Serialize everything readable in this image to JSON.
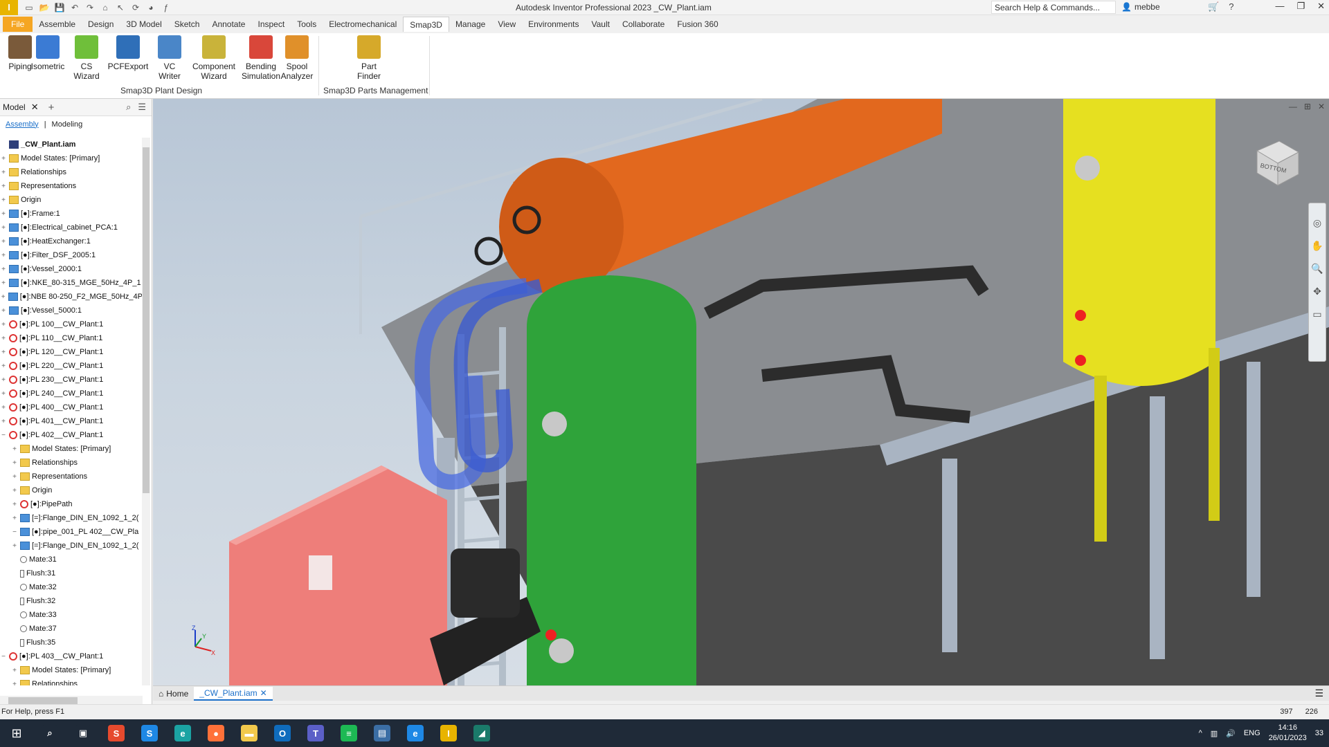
{
  "window": {
    "title": "Autodesk Inventor Professional 2023   _CW_Plant.iam",
    "search_placeholder": "Search Help & Commands...",
    "user": "mebbe"
  },
  "menu_tabs": [
    "File",
    "Assemble",
    "Design",
    "3D Model",
    "Sketch",
    "Annotate",
    "Inspect",
    "Tools",
    "Electromechanical",
    "Smap3D",
    "Manage",
    "View",
    "Environments",
    "Vault",
    "Collaborate",
    "Fusion 360"
  ],
  "active_tab": "Smap3D",
  "ribbon": {
    "buttons": [
      {
        "label": "Piping",
        "color": "#7a5a3a"
      },
      {
        "label": "Isometric",
        "color": "#3b7bd4"
      },
      {
        "label": "CS Wizard",
        "color": "#6fbf3a"
      },
      {
        "label": "PCFExport",
        "color": "#2f6fb8"
      },
      {
        "label": "VC Writer",
        "color": "#4a86c8"
      },
      {
        "label": "Component Wizard",
        "color": "#c9b33a"
      },
      {
        "label": "Bending Simulation",
        "color": "#d9473a"
      },
      {
        "label": "Spool Analyzer",
        "color": "#e0902a"
      },
      {
        "label": "Part Finder",
        "color": "#d6a92a"
      }
    ],
    "panel_plant": "Smap3D Plant Design",
    "panel_parts": "Smap3D Parts Management"
  },
  "browser": {
    "tab": "Model",
    "sub_assembly": "Assembly",
    "sub_modeling": "Modeling",
    "root": "_CW_Plant.iam",
    "nodes": [
      {
        "label": "Model States: [Primary]",
        "icon": "folder",
        "indent": 0
      },
      {
        "label": "Relationships",
        "icon": "folder",
        "indent": 0
      },
      {
        "label": "Representations",
        "icon": "folder",
        "indent": 0
      },
      {
        "label": "Origin",
        "icon": "folder",
        "indent": 0
      },
      {
        "label": "[●]:Frame:1",
        "icon": "part",
        "indent": 0
      },
      {
        "label": "[●]:Electrical_cabinet_PCA:1",
        "icon": "part",
        "indent": 0
      },
      {
        "label": "[●]:HeatExchanger:1",
        "icon": "part",
        "indent": 0
      },
      {
        "label": "[●]:Filter_DSF_2005:1",
        "icon": "part",
        "indent": 0
      },
      {
        "label": "[●]:Vessel_2000:1",
        "icon": "part",
        "indent": 0
      },
      {
        "label": "[●]:NKE_80-315_MGE_50Hz_4P_1",
        "icon": "part",
        "indent": 0
      },
      {
        "label": "[●]:NBE 80-250_F2_MGE_50Hz_4P",
        "icon": "part",
        "indent": 0
      },
      {
        "label": "[●]:Vessel_5000:1",
        "icon": "part",
        "indent": 0
      },
      {
        "label": "[●]:PL 100__CW_Plant:1",
        "icon": "sync",
        "indent": 0
      },
      {
        "label": "[●]:PL 110__CW_Plant:1",
        "icon": "sync",
        "indent": 0
      },
      {
        "label": "[●]:PL 120__CW_Plant:1",
        "icon": "sync",
        "indent": 0
      },
      {
        "label": "[●]:PL 220__CW_Plant:1",
        "icon": "sync",
        "indent": 0
      },
      {
        "label": "[●]:PL 230__CW_Plant:1",
        "icon": "sync",
        "indent": 0
      },
      {
        "label": "[●]:PL 240__CW_Plant:1",
        "icon": "sync",
        "indent": 0
      },
      {
        "label": "[●]:PL 400__CW_Plant:1",
        "icon": "sync",
        "indent": 0
      },
      {
        "label": "[●]:PL 401__CW_Plant:1",
        "icon": "sync",
        "indent": 0
      },
      {
        "label": "[●]:PL 402__CW_Plant:1",
        "icon": "sync",
        "indent": 0
      },
      {
        "label": "Model States: [Primary]",
        "icon": "folder",
        "indent": 1
      },
      {
        "label": "Relationships",
        "icon": "folder",
        "indent": 1
      },
      {
        "label": "Representations",
        "icon": "folder",
        "indent": 1
      },
      {
        "label": "Origin",
        "icon": "folder",
        "indent": 1
      },
      {
        "label": "[●]:PipePath",
        "icon": "sync",
        "indent": 1
      },
      {
        "label": "[=]:Flange_DIN_EN_1092_1_2(",
        "icon": "part",
        "indent": 1
      },
      {
        "label": "[●]:pipe_001_PL 402__CW_Pla",
        "icon": "part",
        "indent": 1
      },
      {
        "label": "[=]:Flange_DIN_EN_1092_1_2(",
        "icon": "part",
        "indent": 1
      },
      {
        "label": "Mate:31",
        "icon": "mate",
        "indent": 1
      },
      {
        "label": "Flush:31",
        "icon": "flush",
        "indent": 1
      },
      {
        "label": "Mate:32",
        "icon": "mate",
        "indent": 1
      },
      {
        "label": "Flush:32",
        "icon": "flush",
        "indent": 1
      },
      {
        "label": "Mate:33",
        "icon": "mate",
        "indent": 1
      },
      {
        "label": "Mate:37",
        "icon": "mate",
        "indent": 1
      },
      {
        "label": "Flush:35",
        "icon": "flush",
        "indent": 1
      },
      {
        "label": "[●]:PL 403__CW_Plant:1",
        "icon": "sync",
        "indent": 0
      },
      {
        "label": "Model States: [Primary]",
        "icon": "folder",
        "indent": 1
      },
      {
        "label": "Relationships",
        "icon": "folder",
        "indent": 1
      }
    ]
  },
  "viewcube_label": "BOTTOM",
  "doc_tabs": {
    "home": "Home",
    "active": "_CW_Plant.iam"
  },
  "status": {
    "help": "For Help, press F1",
    "n1": "397",
    "n2": "226"
  },
  "taskbar": {
    "time": "14:16",
    "date": "26/01/2023",
    "lang": "ENG",
    "notif": "33",
    "apps": [
      {
        "name": "search-app",
        "color": "#1f2a38",
        "glyph": "⌕"
      },
      {
        "name": "task-view-app",
        "color": "#1f2a38",
        "glyph": "▣"
      },
      {
        "name": "smap-app",
        "color": "#e64a2e",
        "glyph": "S"
      },
      {
        "name": "skype-app",
        "color": "#1e88e5",
        "glyph": "S"
      },
      {
        "name": "edge-app",
        "color": "#1ba3a3",
        "glyph": "e"
      },
      {
        "name": "firefox-app",
        "color": "#ff7139",
        "glyph": "●"
      },
      {
        "name": "explorer-app",
        "color": "#f2c94c",
        "glyph": "▬"
      },
      {
        "name": "outlook-app",
        "color": "#0f6cbd",
        "glyph": "O"
      },
      {
        "name": "teams-app",
        "color": "#5b5fc7",
        "glyph": "T"
      },
      {
        "name": "spotify-app",
        "color": "#1db954",
        "glyph": "≡"
      },
      {
        "name": "gallery-app",
        "color": "#3b6ea5",
        "glyph": "▤"
      },
      {
        "name": "ie-app",
        "color": "#1e88e5",
        "glyph": "e"
      },
      {
        "name": "inventor-app",
        "color": "#e8b400",
        "glyph": "I"
      },
      {
        "name": "other-app",
        "color": "#1a7a6a",
        "glyph": "◢"
      }
    ]
  }
}
